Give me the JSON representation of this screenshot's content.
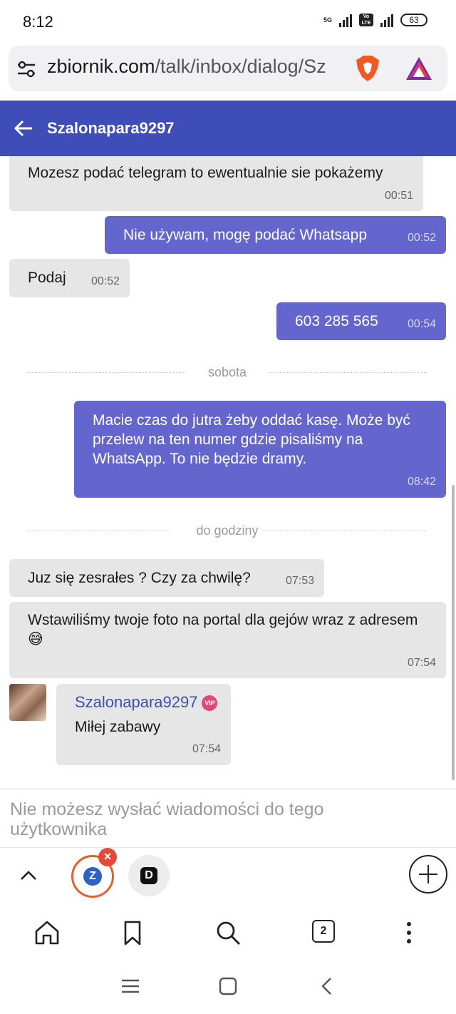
{
  "status_bar": {
    "time": "8:12",
    "network_tag": "5G",
    "volte_tag": "Vo LTE",
    "battery": "63"
  },
  "browser": {
    "url_host": "zbiornik.com",
    "url_path": "/talk/inbox/dialog/Sz",
    "tab_count": "2"
  },
  "header": {
    "title": "Szalonapara9297"
  },
  "messages": [
    {
      "dir": "in",
      "text": "Mozesz podać telegram to ewentualnie sie pokażemy",
      "time": "00:51"
    },
    {
      "dir": "out",
      "text": "Nie używam, mogę podać Whatsapp",
      "time": "00:52"
    },
    {
      "dir": "in",
      "text": "Podaj",
      "time": "00:52"
    },
    {
      "dir": "out",
      "text": "603 285 565",
      "time": "00:54"
    },
    {
      "dir": "out",
      "text": "Macie czas do jutra żeby oddać kasę. Może być przelew na ten numer gdzie pisaliśmy na WhatsApp. To nie będzie dramy.",
      "time": "08:42"
    },
    {
      "dir": "in",
      "text": "Juz się zesrałes ? Czy za chwilę?",
      "time": "07:53"
    },
    {
      "dir": "in",
      "text": "Wstawiliśmy twoje foto na portal dla gejów wraz z adresem 😅",
      "time": "07:54"
    },
    {
      "dir": "in",
      "sender": "Szalonapara9297",
      "badge": "VIP",
      "text": "Miłej zabawy",
      "time": "07:54"
    }
  ],
  "dividers": [
    "sobota",
    "do godziny"
  ],
  "compose": {
    "notice": "Nie możesz wysłać wiadomości do tego użytkownika"
  },
  "tabs": {
    "active_tab_letter": "Z",
    "other_tab_letter": "D"
  },
  "colors": {
    "header": "#3f4db8",
    "outgoing": "#6466ce",
    "incoming": "#e6e6e6",
    "vip": "#e2457c"
  }
}
